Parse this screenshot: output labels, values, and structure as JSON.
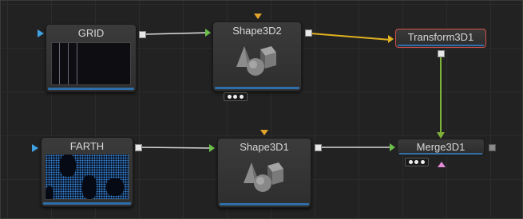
{
  "flow": {
    "nodes": {
      "grid": {
        "label": "GRID"
      },
      "shape3d2": {
        "label": "Shape3D2"
      },
      "transform3d1": {
        "label": "Transform3D1"
      },
      "earth": {
        "label": "FARTH"
      },
      "shape3d1": {
        "label": "Shape3D1"
      },
      "merge3d1": {
        "label": "Merge3D1"
      }
    },
    "colors": {
      "background": "#222222",
      "wire_white": "#d8d8d8",
      "wire_yellow": "#e0b020",
      "wire_green": "#7fb23a",
      "input_blue": "#3fa0e0",
      "input_green": "#6cc04a",
      "input_yellow": "#e0a52a",
      "input_pink": "#e58ad8",
      "selection_red": "#d0504a",
      "node_underline": "#2f6ea8"
    }
  }
}
